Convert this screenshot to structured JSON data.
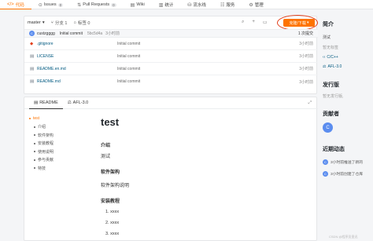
{
  "nav": {
    "tabs": [
      {
        "icon": "code-icon",
        "label": "代码",
        "active": true
      },
      {
        "icon": "issues-icon",
        "label": "Issues",
        "badge": "0"
      },
      {
        "icon": "pull-request-icon",
        "label": "Pull Requests",
        "badge": "0"
      },
      {
        "icon": "wiki-icon",
        "label": "Wiki"
      },
      {
        "icon": "stats-icon",
        "label": "统计"
      },
      {
        "icon": "pipeline-icon",
        "label": "流水线"
      },
      {
        "icon": "service-icon",
        "label": "服务"
      },
      {
        "icon": "manage-icon",
        "label": "管理"
      }
    ]
  },
  "toolbar": {
    "branch": "master",
    "branches": "分支 1",
    "tags": "标签 0",
    "clone_label": "克隆/下载"
  },
  "commit": {
    "avatar": "C",
    "author": "custzgggg",
    "message": "Initial commit",
    "hash": "5bc5d4a",
    "time": "3小时前",
    "count": "1 次提交"
  },
  "files": [
    {
      "icon": "git-icon",
      "name": ".gitignore",
      "message": "Initial commit",
      "time": "3小时前"
    },
    {
      "icon": "file-icon",
      "name": "LICENSE",
      "message": "Initial commit",
      "time": "3小时前"
    },
    {
      "icon": "file-icon",
      "name": "README.en.md",
      "message": "Initial commit",
      "time": "3小时前"
    },
    {
      "icon": "file-icon",
      "name": "README.md",
      "message": "Initial commit",
      "time": "3小时前"
    }
  ],
  "readme_tabs": [
    {
      "label": "README",
      "active": true
    },
    {
      "label": "AFL-3.0"
    }
  ],
  "toc": [
    {
      "label": "test",
      "level": 1
    },
    {
      "label": "介绍",
      "level": 2
    },
    {
      "label": "软件架构",
      "level": 2
    },
    {
      "label": "安装教程",
      "level": 2
    },
    {
      "label": "使用说明",
      "level": 2
    },
    {
      "label": "参与贡献",
      "level": 2
    },
    {
      "label": "特技",
      "level": 2
    }
  ],
  "markdown": {
    "title": "test",
    "h_intro": "介绍",
    "p_intro": "测试",
    "h_arch": "软件架构",
    "p_arch": "软件架构说明",
    "h_install": "安装教程",
    "items": [
      "1. xxxx",
      "2. xxxx",
      "3. xxxx"
    ]
  },
  "sidebar": {
    "intro_title": "简介",
    "intro_text": "测试",
    "no_tags": "暂无标签",
    "lang": "C/C++",
    "license": "AFL-3.0",
    "release_title": "发行版",
    "release_text": "暂无发行版,",
    "contrib_title": "贡献者",
    "contrib_avatar": "C",
    "activity_title": "近期动态",
    "activity": [
      {
        "avatar": "C",
        "text": "3小时前推送了新的"
      },
      {
        "avatar": "C",
        "text": "3小时前创建了仓库"
      }
    ]
  },
  "watermark": "CSDN @程序员皇迅"
}
